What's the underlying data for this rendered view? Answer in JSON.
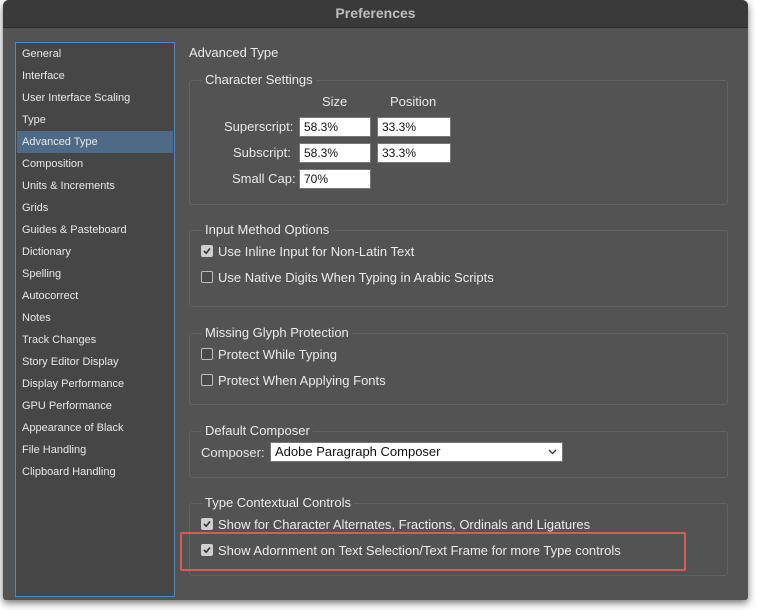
{
  "window": {
    "title": "Preferences"
  },
  "sidebar": {
    "items": [
      {
        "label": "General"
      },
      {
        "label": "Interface"
      },
      {
        "label": "User Interface Scaling"
      },
      {
        "label": "Type"
      },
      {
        "label": "Advanced Type",
        "selected": true
      },
      {
        "label": "Composition"
      },
      {
        "label": "Units & Increments"
      },
      {
        "label": "Grids"
      },
      {
        "label": "Guides & Pasteboard"
      },
      {
        "label": "Dictionary"
      },
      {
        "label": "Spelling"
      },
      {
        "label": "Autocorrect"
      },
      {
        "label": "Notes"
      },
      {
        "label": "Track Changes"
      },
      {
        "label": "Story Editor Display"
      },
      {
        "label": "Display Performance"
      },
      {
        "label": "GPU Performance"
      },
      {
        "label": "Appearance of Black"
      },
      {
        "label": "File Handling"
      },
      {
        "label": "Clipboard Handling"
      }
    ]
  },
  "main": {
    "title": "Advanced Type",
    "character_settings": {
      "title": "Character Settings",
      "col_size": "Size",
      "col_position": "Position",
      "superscript": {
        "label": "Superscript:",
        "size": "58.3%",
        "position": "33.3%"
      },
      "subscript": {
        "label": "Subscript:",
        "size": "58.3%",
        "position": "33.3%"
      },
      "small_cap": {
        "label": "Small Cap:",
        "size": "70%"
      }
    },
    "input_method": {
      "title": "Input Method Options",
      "inline_input": {
        "label": "Use Inline Input for Non-Latin Text",
        "checked": true
      },
      "native_digits": {
        "label": "Use Native Digits When Typing in Arabic Scripts",
        "checked": false
      }
    },
    "missing_glyph": {
      "title": "Missing Glyph Protection",
      "while_typing": {
        "label": "Protect While Typing",
        "checked": false
      },
      "applying_fonts": {
        "label": "Protect When Applying Fonts",
        "checked": false
      }
    },
    "default_composer": {
      "title": "Default Composer",
      "label": "Composer:",
      "value": "Adobe Paragraph Composer"
    },
    "contextual_controls": {
      "title": "Type Contextual Controls",
      "alternates": {
        "label": "Show for Character Alternates, Fractions, Ordinals and Ligatures",
        "checked": true
      },
      "adornment": {
        "label": "Show Adornment on Text Selection/Text Frame for more Type controls",
        "checked": true
      }
    }
  },
  "colors": {
    "window_bg": "#535353",
    "selection": "#4e6a87",
    "highlight": "#d95a5a"
  }
}
